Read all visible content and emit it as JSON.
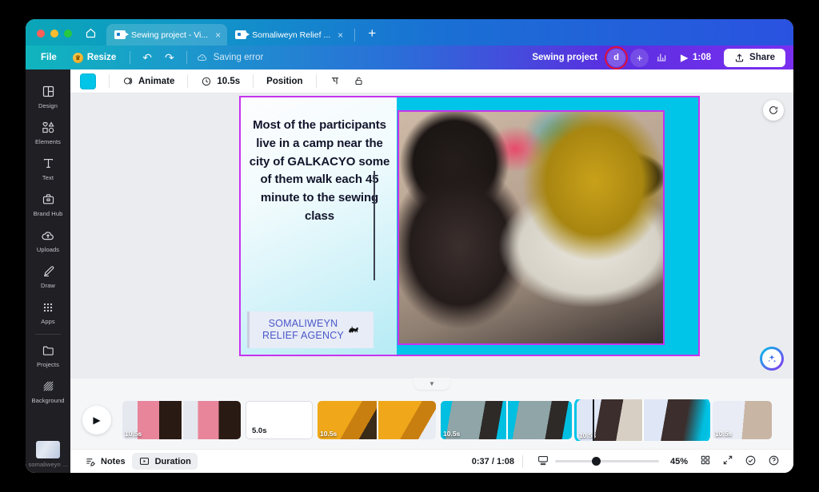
{
  "browser": {
    "home_icon": "home-icon",
    "tabs": [
      {
        "label": "Sewing project - Vi...",
        "icon": "video-file-icon",
        "close": "×",
        "active": true
      },
      {
        "label": "Somaliweyn Relief ...",
        "icon": "video-file-icon",
        "close": "×",
        "active": false
      }
    ],
    "new_tab": "+"
  },
  "menubar": {
    "file": "File",
    "resize": "Resize",
    "resize_icon": "crown-icon",
    "undo_icon": "↶",
    "redo_icon": "↷",
    "saving_status": "Saving error",
    "saving_icon": "cloud-alert-icon",
    "doc_name": "Sewing project",
    "avatar_initial": "d",
    "avatar_highlight_color": "#e1103a",
    "add_collaborator": "+",
    "insights_icon": "bar-chart-icon",
    "play_icon": "▶",
    "total_time": "1:08",
    "share": "Share",
    "share_icon": "upload-icon"
  },
  "sidebar": {
    "items": [
      {
        "label": "Design",
        "icon": "layout-icon"
      },
      {
        "label": "Elements",
        "icon": "shapes-icon"
      },
      {
        "label": "Text",
        "icon": "text-icon"
      },
      {
        "label": "Brand Hub",
        "icon": "briefcase-icon"
      },
      {
        "label": "Uploads",
        "icon": "cloud-upload-icon"
      },
      {
        "label": "Draw",
        "icon": "pen-icon"
      },
      {
        "label": "Apps",
        "icon": "grid-dots-icon"
      },
      {
        "label": "Projects",
        "icon": "folder-icon"
      },
      {
        "label": "Background",
        "icon": "hatch-pattern-icon"
      }
    ],
    "project_thumb_label": "somaliweyn ..."
  },
  "context_toolbar": {
    "color_value": "#00c4e8",
    "animate": "Animate",
    "animate_icon": "animate-icon",
    "duration": "10.5s",
    "duration_icon": "clock-icon",
    "position": "Position",
    "transparency_icon": "transparency-icon",
    "lock_icon": "lock-icon"
  },
  "canvas": {
    "background_color": "#00c4e8",
    "selection_color": "#c633f0",
    "headline": "Most of the participants live in a camp near the city of GALKACYO some of them walk each 45 minute to the sewing class",
    "logo_line1": "SOMALIWEYN",
    "logo_line2": "RELIEF AGENCY",
    "logo_icon": "camel-icon",
    "rotate_icon": "rotate-icon",
    "magic_icon": "magic-sparkle-icon",
    "photo_alt": "woman-at-sewing-machine-photo"
  },
  "timeline": {
    "collapse_icon": "chevron-down-icon",
    "play_icon": "▶",
    "clips": [
      {
        "duration": "10.5s",
        "selected": false,
        "style": "pink-dress-scene"
      },
      {
        "duration": "5.0s",
        "selected": false,
        "style": "blank"
      },
      {
        "duration": "10.5s",
        "selected": false,
        "style": "orange-dress-scene"
      },
      {
        "duration": "10.5s",
        "selected": false,
        "style": "teal-robe-scene"
      },
      {
        "duration": "10.5s",
        "selected": true,
        "style": "sewing-class-scene"
      },
      {
        "duration": "10.5s",
        "selected": false,
        "style": "text-card-scene"
      }
    ]
  },
  "statusbar": {
    "notes": "Notes",
    "notes_icon": "notes-icon",
    "duration": "Duration",
    "duration_icon": "duration-icon",
    "time_position": "0:37 / 1:08",
    "fit_icon": "screen-icon",
    "zoom_level": "45%",
    "grid_icon": "grid-view-icon",
    "fullscreen_icon": "expand-icon",
    "check_icon": "check-circle-icon",
    "help_icon": "help-circle-icon"
  }
}
